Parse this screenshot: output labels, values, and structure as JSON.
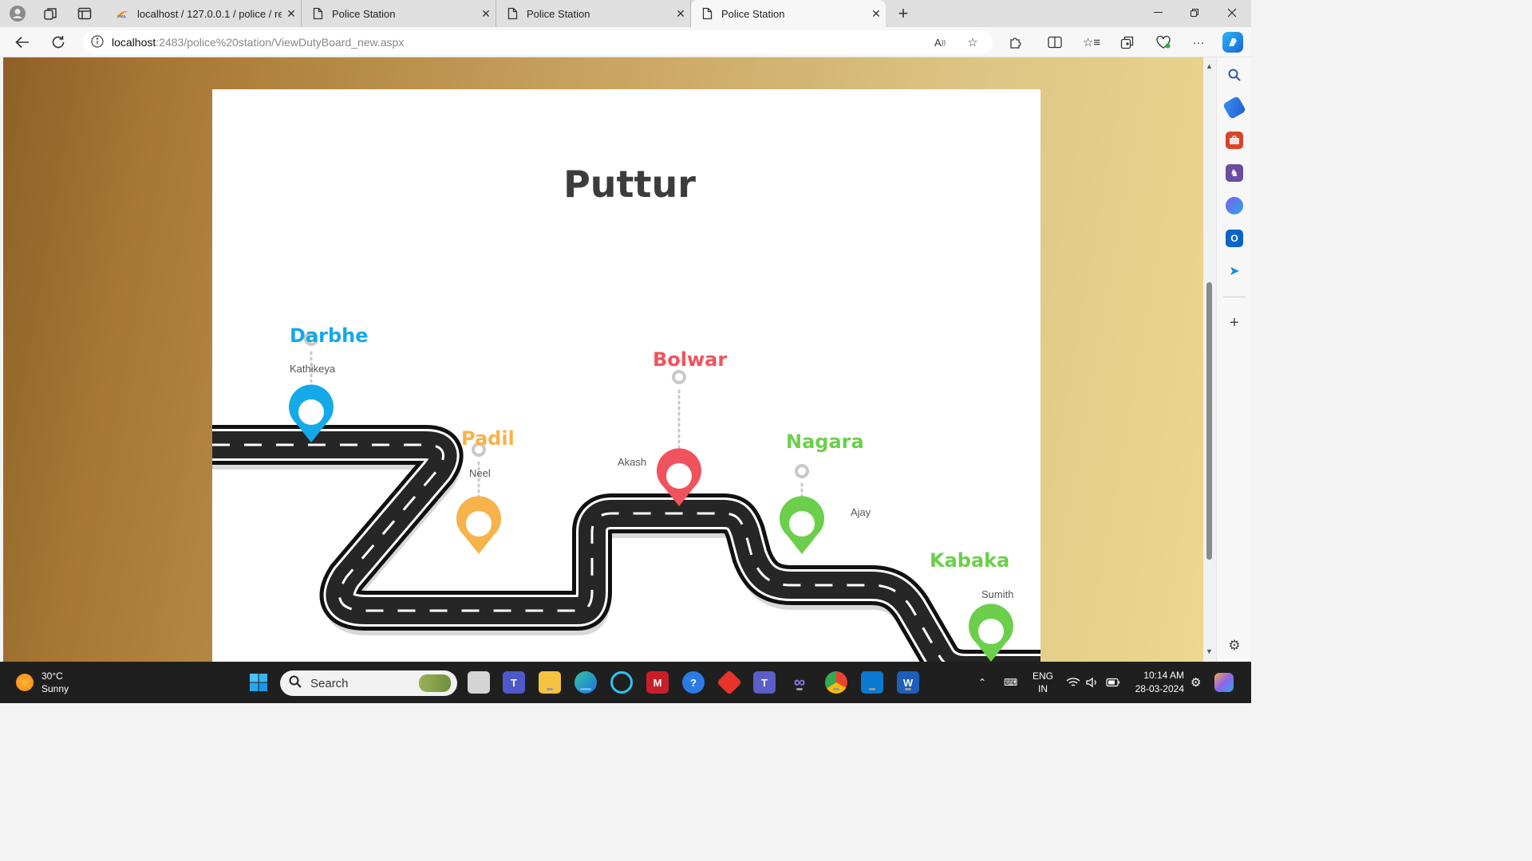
{
  "browser": {
    "tabs": [
      {
        "title": "localhost / 127.0.0.1 / police / re",
        "favicon": "phpmyadmin-icon"
      },
      {
        "title": "Police Station",
        "favicon": "page-icon"
      },
      {
        "title": "Police Station",
        "favicon": "page-icon"
      },
      {
        "title": "Police Station",
        "favicon": "page-icon",
        "active": true
      }
    ],
    "new_tab_glyph": "+",
    "url_host": "localhost",
    "url_rest": ":2483/police%20station/ViewDutyBoard_new.aspx"
  },
  "page": {
    "title": "Puttur",
    "stops": [
      {
        "name": "Darbhe",
        "officer": "Kathikeya",
        "color": "#14a9e8"
      },
      {
        "name": "Padil",
        "officer": "Neel",
        "color": "#f7b24a"
      },
      {
        "name": "Bolwar",
        "officer": "Akash",
        "color": "#f0525e"
      },
      {
        "name": "Nagara",
        "officer": "Ajay",
        "color": "#6ccf4c"
      },
      {
        "name": "Kabaka",
        "officer": "Sumith",
        "color": "#6ccf4c"
      }
    ]
  },
  "taskbar": {
    "weather_temp": "30°C",
    "weather_desc": "Sunny",
    "search_placeholder": "Search",
    "lang_primary": "ENG",
    "lang_region": "IN",
    "time": "10:14 AM",
    "date": "28-03-2024"
  }
}
